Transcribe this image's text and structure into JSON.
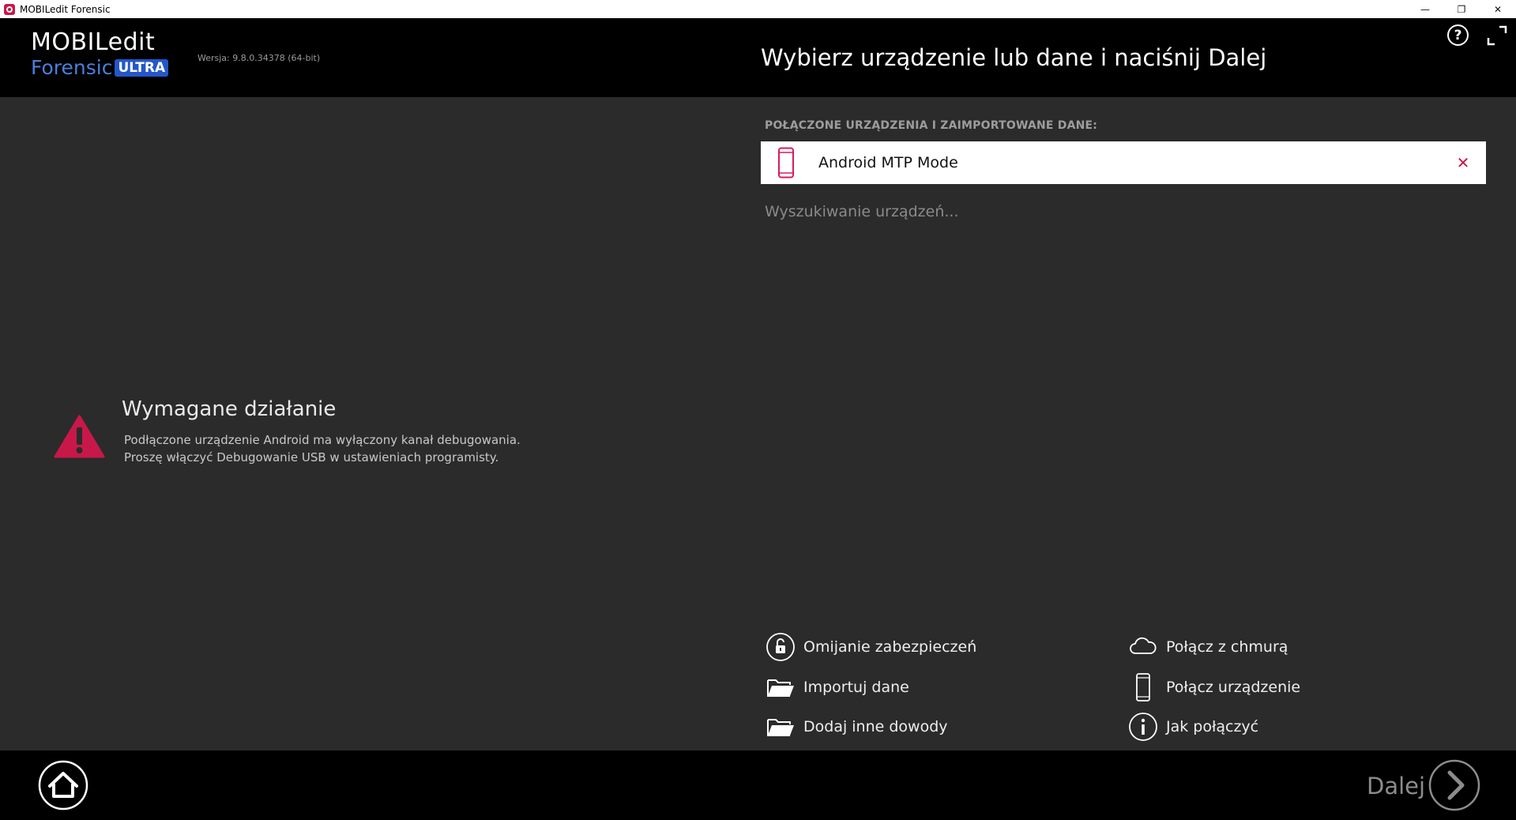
{
  "window": {
    "title": "MOBILedit Forensic",
    "minimize": "—",
    "restore": "❐",
    "close": "✕"
  },
  "header": {
    "logo_top": "MOBILedit",
    "logo_forensic": "Forensic",
    "logo_ultra": "ULTRA",
    "version": "Wersja: 9.8.0.34378 (64-bit)",
    "title": "Wybierz urządzenie lub dane i naciśnij Dalej",
    "help": "?"
  },
  "warning": {
    "title": "Wymagane działanie",
    "line1": "Podłączone urządzenie Android ma wyłączony kanał debugowania.",
    "line2": "Proszę włączyć Debugowanie USB w ustawieniach programisty."
  },
  "devices": {
    "section_label": "POŁĄCZONE URZĄDZENIA I ZAIMPORTOWANE DANE:",
    "items": [
      {
        "name": "Android MTP Mode"
      }
    ],
    "close_glyph": "✕",
    "searching": "Wyszukiwanie urządzeń..."
  },
  "actions": {
    "bypass": "Omijanie zabezpieczeń",
    "import": "Importuj dane",
    "add_evidence": "Dodaj inne dowody",
    "cloud": "Połącz z chmurą",
    "connect_device": "Połącz urządzenie",
    "how_connect": "Jak połączyć"
  },
  "footer": {
    "next_label": "Dalej"
  },
  "colors": {
    "accent": "#c8184a",
    "brand_blue": "#2457c9",
    "background": "#2b2b2b",
    "bar": "#000000"
  }
}
